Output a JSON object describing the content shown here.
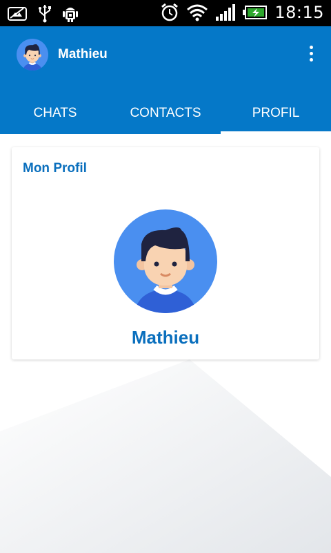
{
  "status_bar": {
    "time": "18:15",
    "icons": [
      "screenshot-icon",
      "usb-icon",
      "android-debug-icon",
      "alarm-icon",
      "wifi-icon",
      "signal-icon",
      "battery-charging-icon"
    ]
  },
  "app_bar": {
    "title": "Mathieu",
    "menu_icon": "overflow-menu-icon",
    "color": "#0578c8"
  },
  "tabs": [
    {
      "label": "CHATS",
      "active": false
    },
    {
      "label": "CONTACTS",
      "active": false
    },
    {
      "label": "PROFIL",
      "active": true
    }
  ],
  "profile_card": {
    "title": "Mon Profil",
    "name": "Mathieu"
  },
  "colors": {
    "accent": "#0a6fbd",
    "avatar_bg": "#4a8ff0"
  }
}
